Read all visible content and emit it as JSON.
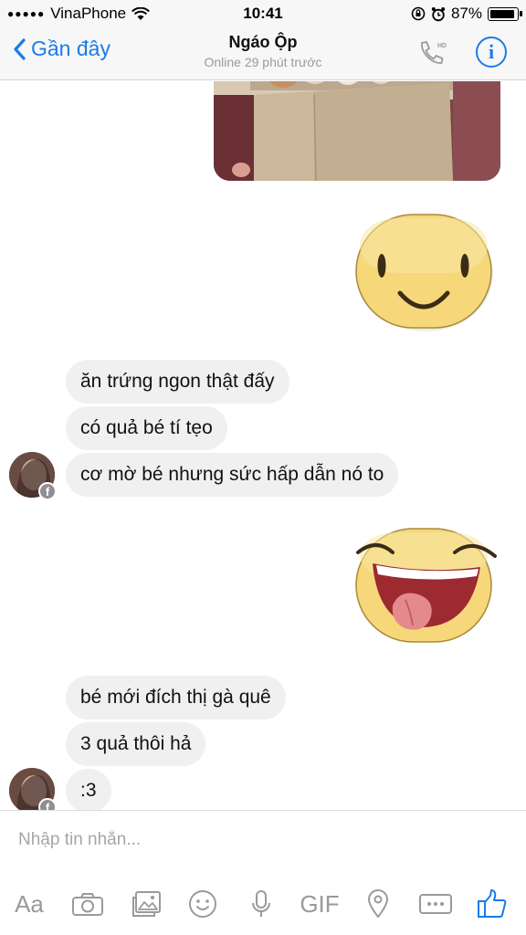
{
  "status_bar": {
    "signal_dots": "●●●●●",
    "carrier": "VinaPhone",
    "time": "10:41",
    "battery_percent": "87%"
  },
  "nav": {
    "back_label": "Gần đây",
    "contact_name": "Ngáo Ộp",
    "presence": "Online 29 phút trước",
    "call_badge": "HD",
    "info_glyph": "i"
  },
  "messages": [
    {
      "side": "outgoing",
      "type": "photo",
      "icon": "eggs-photo"
    },
    {
      "side": "outgoing",
      "type": "sticker",
      "icon": "smiley-sticker"
    },
    {
      "side": "incoming",
      "text": "ăn trứng ngon thật đấy"
    },
    {
      "side": "incoming",
      "text": "có quả bé tí tẹo"
    },
    {
      "side": "incoming",
      "text": "cơ mờ bé nhưng sức hấp dẫn nó to"
    },
    {
      "side": "outgoing",
      "type": "sticker",
      "icon": "tongue-out-sticker"
    },
    {
      "side": "incoming",
      "text": "bé mới đích thị gà quê"
    },
    {
      "side": "incoming",
      "text": "3 quả thôi hả"
    },
    {
      "side": "incoming",
      "text": ":3"
    }
  ],
  "avatar_badge": "f",
  "composer": {
    "placeholder": "Nhập tin nhắn...",
    "text_label": "Aa",
    "gif_label": "GIF",
    "more_label": "ooo"
  },
  "colors": {
    "accent": "#1a7ce8",
    "incoming_bubble": "#f1f0f0",
    "icon_gray": "#9a9a9a",
    "sticker_yellow": "#f6d77a"
  }
}
